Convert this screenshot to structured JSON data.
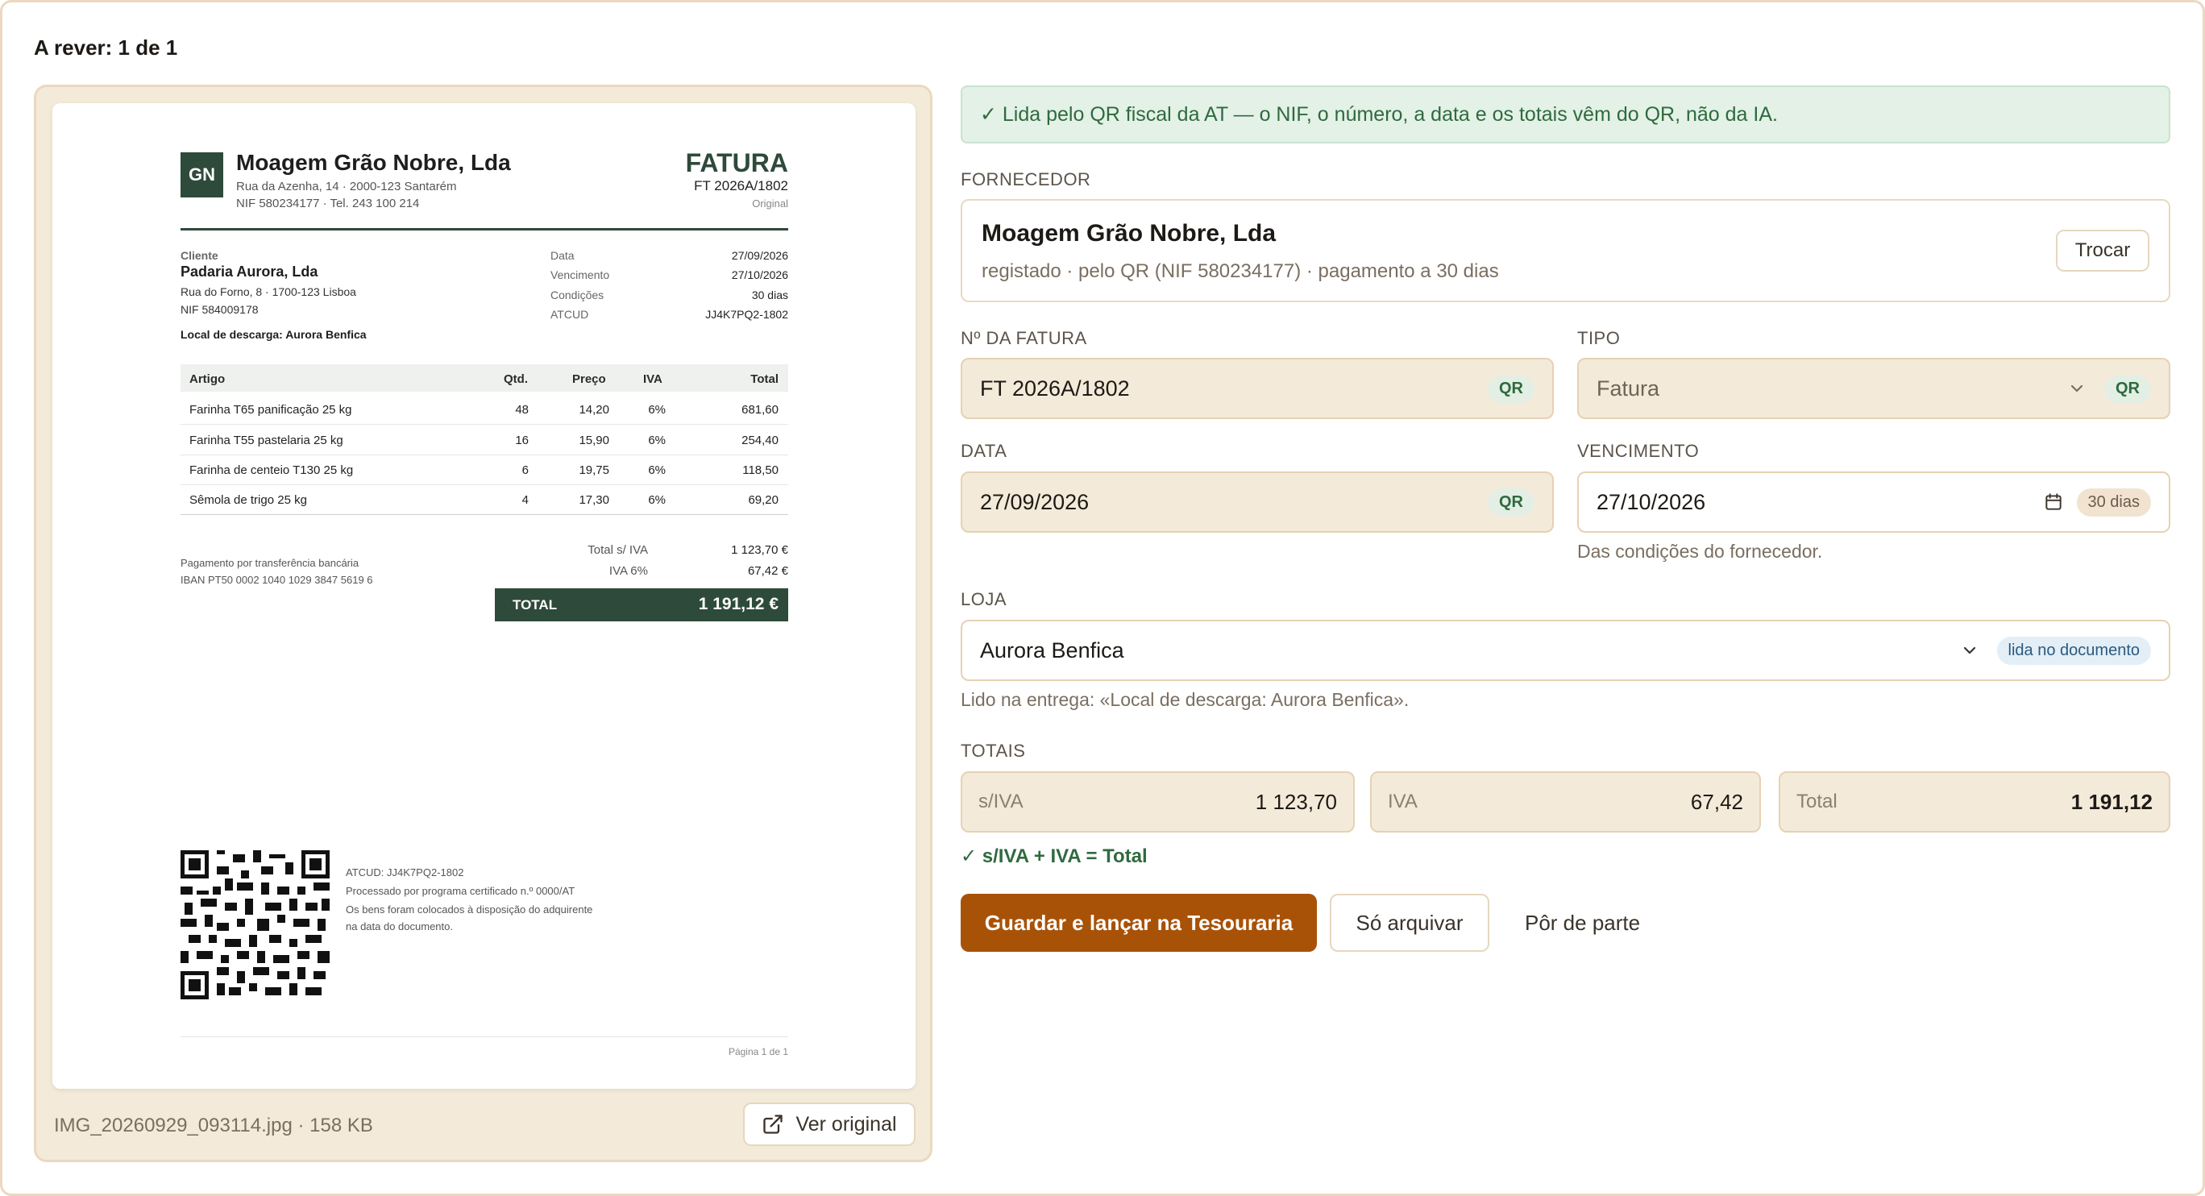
{
  "header": {
    "review_count": "A rever: 1 de 1"
  },
  "document_preview": {
    "file_name": "IMG_20260929_093114.jpg · 158 KB",
    "open_original_label": "Ver original",
    "invoice": {
      "logo_initials": "GN",
      "supplier_name": "Moagem Grão Nobre, Lda",
      "supplier_address": "Rua da Azenha, 14 · 2000-123 Santarém",
      "supplier_contacts": "NIF 580234177 · Tel. 243 100 214",
      "doc_type": "FATURA",
      "doc_number": "FT 2026A/1802",
      "doc_copy": "Original",
      "client_label": "Cliente",
      "client_name": "Padaria Aurora, Lda",
      "client_address": "Rua do Forno, 8 · 1700-123 Lisboa",
      "client_nif": "NIF 584009178",
      "delivery_place": "Local de descarga: Aurora Benfica",
      "meta": [
        {
          "label": "Data",
          "value": "27/09/2026"
        },
        {
          "label": "Vencimento",
          "value": "27/10/2026"
        },
        {
          "label": "Condições",
          "value": "30 dias"
        },
        {
          "label": "ATCUD",
          "value": "JJ4K7PQ2-1802"
        }
      ],
      "table_headers": {
        "item": "Artigo",
        "qty": "Qtd.",
        "price": "Preço",
        "vat": "IVA",
        "total": "Total"
      },
      "lines": [
        {
          "item": "Farinha T65 panificação 25 kg",
          "qty": "48",
          "price": "14,20",
          "vat": "6%",
          "total": "681,60"
        },
        {
          "item": "Farinha T55 pastelaria 25 kg",
          "qty": "16",
          "price": "15,90",
          "vat": "6%",
          "total": "254,40"
        },
        {
          "item": "Farinha de centeio T130 25 kg",
          "qty": "6",
          "price": "19,75",
          "vat": "6%",
          "total": "118,50"
        },
        {
          "item": "Sêmola de trigo 25 kg",
          "qty": "4",
          "price": "17,30",
          "vat": "6%",
          "total": "69,20"
        }
      ],
      "payment_note": "Pagamento por transferência bancária",
      "iban": "IBAN PT50 0002 1040 1029 3847 5619 6",
      "subtotal_label": "Total s/ IVA",
      "subtotal_value": "1 123,70 €",
      "vat_label": "IVA 6%",
      "vat_value": "67,42 €",
      "grand_total_label": "TOTAL",
      "grand_total_value": "1 191,12 €",
      "qr_note_1": "ATCUD: JJ4K7PQ2-1802",
      "qr_note_2": "Processado por programa certificado n.º 0000/AT",
      "qr_note_3": "Os bens foram colocados à disposição do adquirente",
      "qr_note_4": "na data do documento.",
      "page_label": "Página 1 de 1"
    }
  },
  "form": {
    "banner": "✓ Lida pelo QR fiscal da AT — o NIF, o número, a data e os totais vêm do QR, não da IA.",
    "supplier": {
      "label": "Fornecedor",
      "name": "Moagem Grão Nobre, Lda",
      "sub": "registado · pelo QR (NIF 580234177) · pagamento a 30 dias",
      "change_label": "Trocar"
    },
    "invoice_number": {
      "label": "Nº da fatura",
      "value": "FT 2026A/1802",
      "badge": "QR"
    },
    "type": {
      "label": "Tipo",
      "value": "Fatura",
      "badge": "QR"
    },
    "date": {
      "label": "Data",
      "value": "27/09/2026",
      "badge": "QR"
    },
    "due": {
      "label": "Vencimento",
      "value": "27/10/2026",
      "badge": "30 dias",
      "hint": "Das condições do fornecedor."
    },
    "store": {
      "label": "Loja",
      "value": "Aurora Benfica",
      "badge": "lida no documento",
      "hint": "Lido na entrega: «Local de descarga: Aurora Benfica»."
    },
    "totals": {
      "label": "Totais",
      "net_label": "s/IVA",
      "net_value": "1 123,70",
      "vat_label": "IVA",
      "vat_value": "67,42",
      "total_label": "Total",
      "total_value": "1 191,12",
      "check": "✓ s/IVA + IVA = Total"
    },
    "actions": {
      "save_post": "Guardar e lançar na Tesouraria",
      "archive_only": "Só arquivar",
      "set_aside": "Pôr de parte"
    }
  },
  "colors": {
    "accent_button": "#a85208",
    "panel_beige": "#f4ead9",
    "success_green": "#2f6a3f",
    "invoice_green": "#2e4a3a"
  }
}
